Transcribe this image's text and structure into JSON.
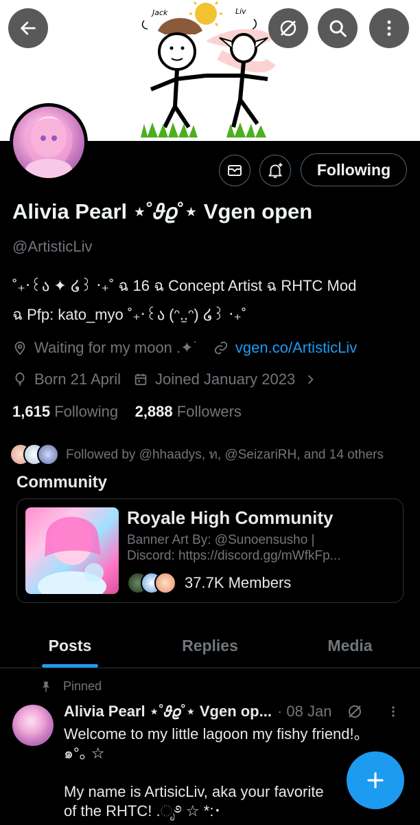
{
  "header": {
    "back_icon": "arrow-left-icon",
    "grok_icon": "grok-icon",
    "search_icon": "search-icon",
    "more_icon": "more-vertical-icon",
    "banner_labels": {
      "left": "Jack",
      "right": "Liv"
    }
  },
  "profile": {
    "name": "Alivia Pearl ⋆˚𝜗𝜚˚⋆ Vgen open",
    "handle": "@ArtisticLiv",
    "follow_label": "Following",
    "bio_line1": "˚₊‧꒰ა ✦ ໒꒱ ‧₊˚  ฉ 16  ฉ Concept Artist  ฉ RHTC Mod",
    "bio_line2": "ฉ Pfp: kato_myo  ˚₊‧꒰ა (ᵔ.̫.ᵔ) ໒꒱ ‧₊˚",
    "location": "Waiting for my moon .✦˙",
    "website": "vgen.co/ArtisticLiv",
    "birthday": "Born 21 April",
    "joined": "Joined January 2023",
    "following_count": "1,615",
    "following_label": "Following",
    "followers_count": "2,888",
    "followers_label": "Followers",
    "followed_by": "Followed by @hhaadys, ท, @SeizariRH, and 14 others"
  },
  "community": {
    "heading": "Community",
    "title": "Royale High Community",
    "desc_line1": "Banner Art By: @Sunoensusho |",
    "desc_line2": "Discord: https://discord.gg/mWfkFp...",
    "members": "37.7K Members"
  },
  "tabs": [
    {
      "label": "Posts",
      "active": true
    },
    {
      "label": "Replies",
      "active": false
    },
    {
      "label": "Media",
      "active": false
    }
  ],
  "post": {
    "pinned_label": "Pinned",
    "author": "Alivia Pearl ⋆˚𝜗𝜚˚⋆ Vgen op...",
    "date": "· 08 Jan",
    "text": "Welcome to my little lagoon my fishy friend!。\n๑°｡ ☆\n\nMy name is ArtisicLiv, aka your favorite\nof the RHTC! .ೃ࿔ ☆ *:･"
  },
  "colors": {
    "accent": "#1d9bf0",
    "background": "#000000",
    "muted_text": "#71767b",
    "border": "#2f3336"
  }
}
